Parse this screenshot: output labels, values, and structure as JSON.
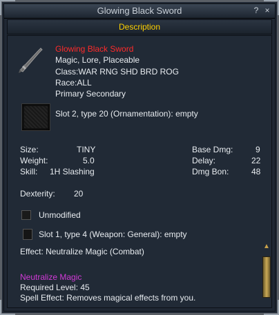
{
  "window": {
    "title": "Glowing Black Sword",
    "help_label": "?",
    "close_label": "×",
    "header": "Description"
  },
  "item": {
    "name": "Glowing Black Sword",
    "flags": "Magic, Lore, Placeable",
    "class": "Class:WAR RNG SHD BRD ROG",
    "race": "Race:ALL",
    "slots": "Primary Secondary",
    "aug_slot_2": "Slot 2, type 20 (Ornamentation): empty",
    "stats_left": [
      {
        "label": "Size:",
        "value": "TINY"
      },
      {
        "label": "Weight:",
        "value": "5.0"
      },
      {
        "label": "Skill:",
        "value": "1H Slashing"
      }
    ],
    "stats_right": [
      {
        "label": "Base Dmg:",
        "value": "9"
      },
      {
        "label": "Delay:",
        "value": "22"
      },
      {
        "label": "Dmg Bon:",
        "value": "48"
      }
    ],
    "dexterity": {
      "label": "Dexterity:",
      "value": "20"
    },
    "unmodified": "Unmodified",
    "aug_slot_1": "Slot 1, type 4 (Weapon: General): empty",
    "effect": "Effect: Neutralize Magic (Combat)"
  },
  "spell": {
    "name": "Neutralize Magic",
    "required_level": "Required Level: 45",
    "spell_effect": "Spell Effect: Removes magical effects from you."
  },
  "colors": {
    "item_name": "#ff2a2a",
    "spell_name": "#d23ad8",
    "header_text": "#ffd200"
  }
}
